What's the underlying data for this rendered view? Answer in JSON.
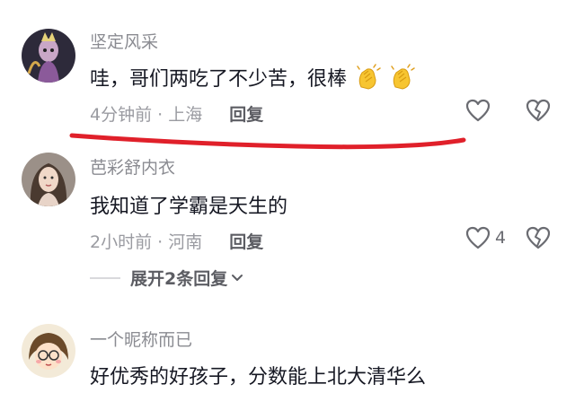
{
  "comments": [
    {
      "username": "坚定风采",
      "text": "哇，哥们两吃了不少苦，很棒",
      "emojis": [
        "clapping-hands-icon",
        "clapping-hands-icon"
      ],
      "time_location": "4分钟前 · 上海",
      "reply_label": "回复",
      "like_count": ""
    },
    {
      "username": "芭彩舒内衣",
      "text": "我知道了学霸是天生的",
      "time_location": "2小时前 · 河南",
      "reply_label": "回复",
      "like_count": "4"
    },
    {
      "username": "一个昵称而已",
      "text": "好优秀的好孩子，分数能上北大清华么"
    }
  ],
  "expand_replies_label": "展开2条回复",
  "colors": {
    "username": "#8a8b91",
    "text": "#161823",
    "meta": "#9a9ba1",
    "annotation": "#e0202a"
  }
}
